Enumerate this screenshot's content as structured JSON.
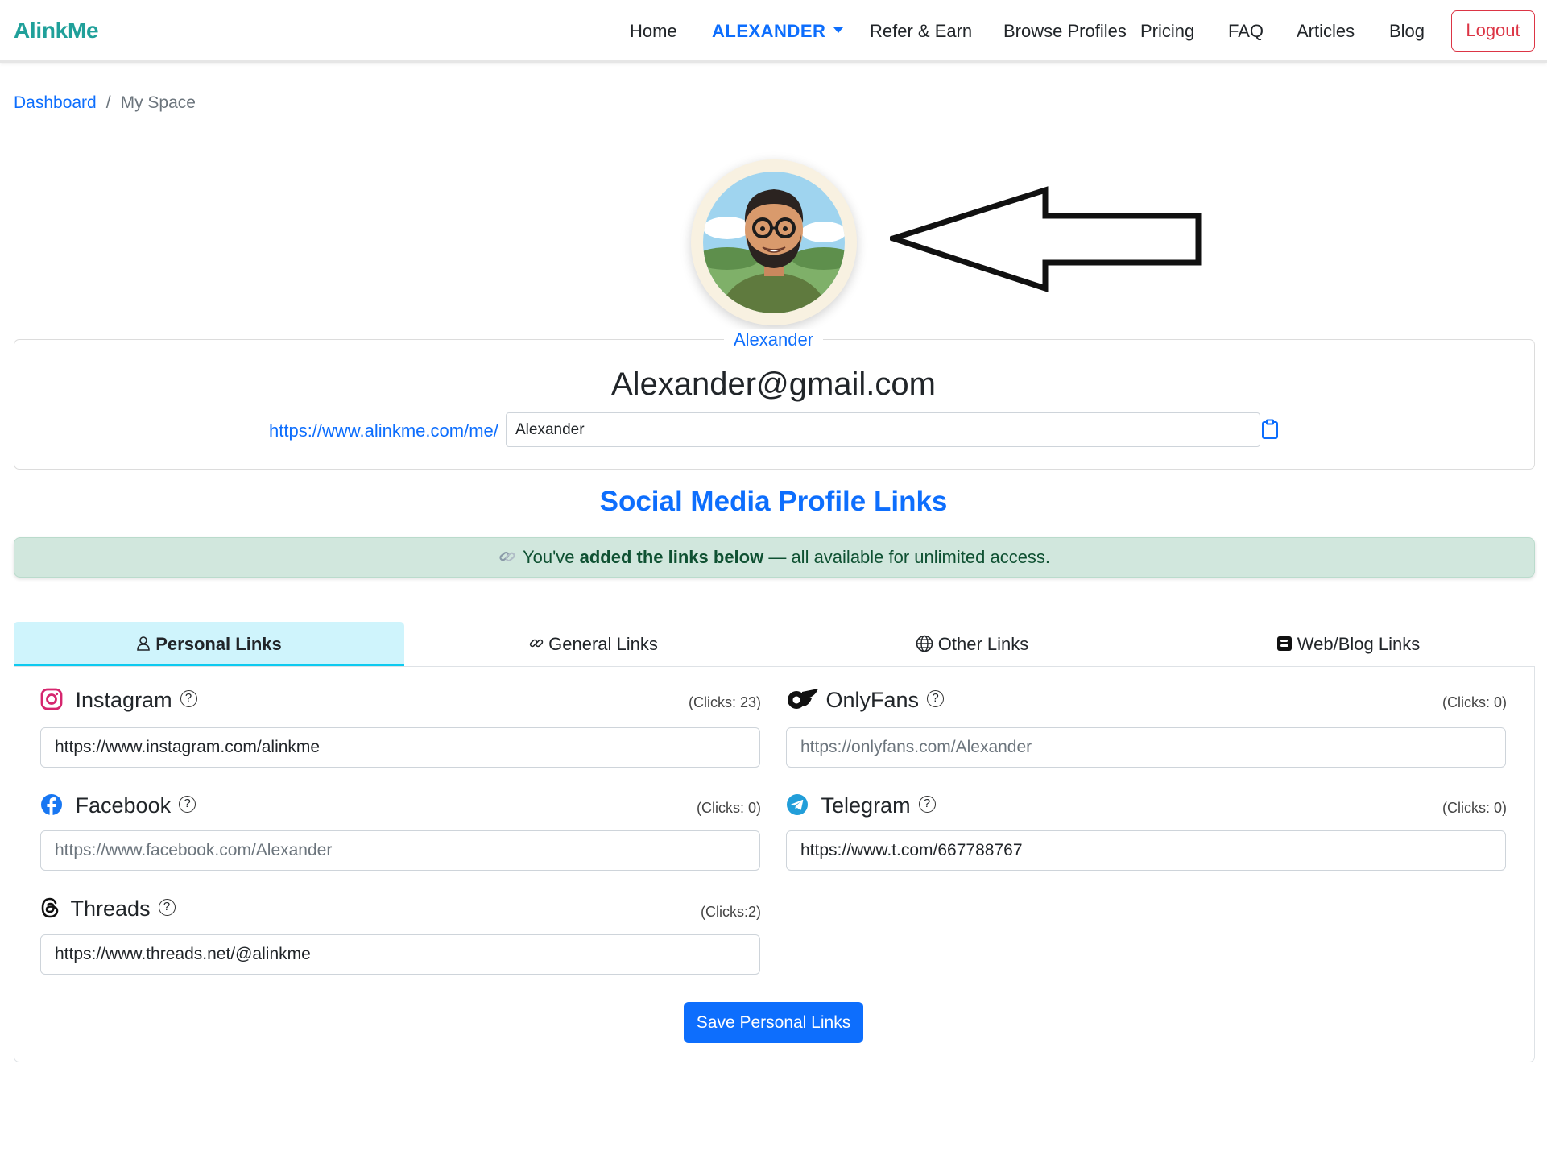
{
  "navbar": {
    "brand": "AlinkMe",
    "items": {
      "home": "Home",
      "user": "ALEXANDER",
      "refer": "Refer & Earn",
      "browse": "Browse Profiles",
      "pricing": "Pricing",
      "faq": "FAQ",
      "articles": "Articles",
      "blog": "Blog"
    },
    "logout": "Logout",
    "brand_color": "#20a09a",
    "accent_color": "#0d6efd",
    "logout_color": "#dc3545"
  },
  "breadcrumb": {
    "parent": "Dashboard",
    "separator": "/",
    "current": "My Space"
  },
  "profile": {
    "display_name": "Alexander",
    "email": "Alexander@gmail.com",
    "url_prefix": "https://www.alinkme.com/me/",
    "slug": "Alexander"
  },
  "section_title": "Social Media Profile Links",
  "alert": {
    "icon": "link-icon",
    "text_before": "You've ",
    "text_bold": "added the links below",
    "text_after": " — all available for unlimited access.",
    "background_color": "#d1e7dd"
  },
  "tabs": [
    {
      "label": "Personal Links",
      "icon": "person-icon",
      "active": true
    },
    {
      "label": "General Links",
      "icon": "link-icon",
      "active": false
    },
    {
      "label": "Other Links",
      "icon": "globe-icon",
      "active": false
    },
    {
      "label": "Web/Blog Links",
      "icon": "blogger-icon",
      "active": false
    }
  ],
  "links": {
    "instagram": {
      "label": "Instagram",
      "clicks": "(Clicks: 23)",
      "value": "https://www.instagram.com/alinkme",
      "placeholder": ""
    },
    "onlyfans": {
      "label": "OnlyFans",
      "clicks": "(Clicks: 0)",
      "value": "",
      "placeholder": "https://onlyfans.com/Alexander"
    },
    "facebook": {
      "label": "Facebook",
      "clicks": "(Clicks: 0)",
      "value": "",
      "placeholder": "https://www.facebook.com/Alexander"
    },
    "telegram": {
      "label": "Telegram",
      "clicks": "(Clicks: 0)",
      "value": "https://www.t.com/667788767",
      "placeholder": ""
    },
    "threads": {
      "label": "Threads",
      "clicks": "(Clicks:2)",
      "value": "https://www.threads.net/@alinkme",
      "placeholder": ""
    }
  },
  "help_glyph": "?",
  "save_button": "Save Personal Links"
}
